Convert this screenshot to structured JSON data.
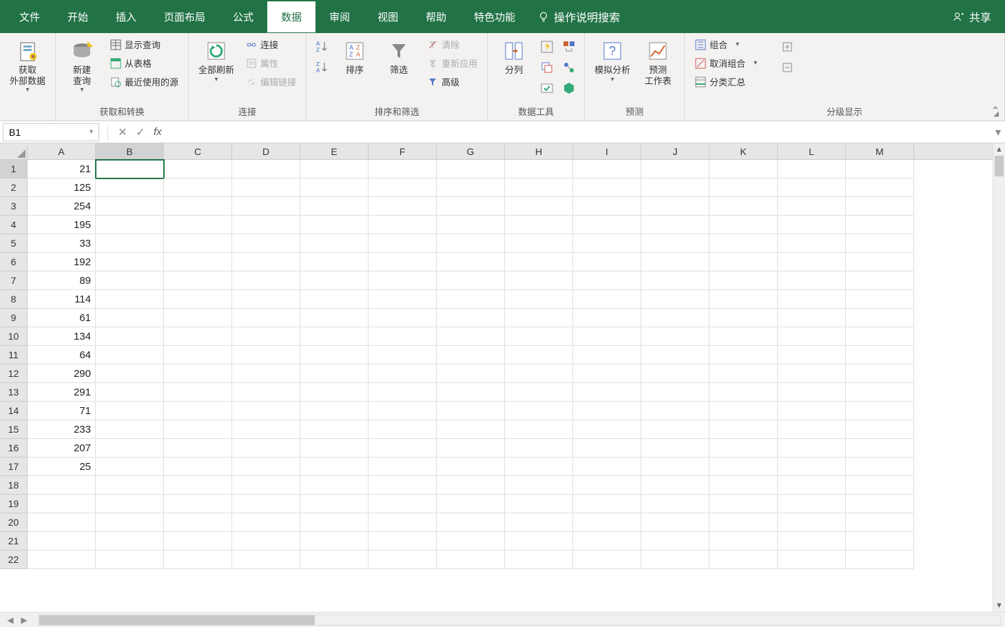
{
  "menubar": {
    "tabs": [
      "文件",
      "开始",
      "插入",
      "页面布局",
      "公式",
      "数据",
      "审阅",
      "视图",
      "帮助",
      "特色功能"
    ],
    "active_index": 5,
    "search_placeholder": "操作说明搜索",
    "share_label": "共享"
  },
  "ribbon": {
    "groups": [
      {
        "label": "",
        "big": [
          {
            "label": "获取\n外部数据",
            "caret": true
          }
        ]
      },
      {
        "label": "获取和转换",
        "big": [
          {
            "label": "新建\n查询",
            "caret": true
          }
        ],
        "small": [
          "显示查询",
          "从表格",
          "最近使用的源"
        ]
      },
      {
        "label": "连接",
        "big": [
          {
            "label": "全部刷新",
            "caret": true
          }
        ],
        "small": [
          "连接",
          "属性",
          "编辑链接"
        ],
        "small_disabled": [
          false,
          true,
          true
        ]
      },
      {
        "label": "排序和筛选",
        "big": [
          {
            "label": "排序"
          },
          {
            "label": "筛选"
          }
        ],
        "small": [
          "清除",
          "重新应用",
          "高级"
        ],
        "small_disabled": [
          true,
          true,
          false
        ]
      },
      {
        "label": "数据工具",
        "big": [
          {
            "label": "分列"
          }
        ]
      },
      {
        "label": "预测",
        "big": [
          {
            "label": "模拟分析",
            "caret": true
          },
          {
            "label": "预测\n工作表"
          }
        ]
      },
      {
        "label": "分级显示",
        "small": [
          "组合",
          "取消组合",
          "分类汇总"
        ],
        "small_caret": [
          true,
          true,
          false
        ]
      }
    ]
  },
  "formula_bar": {
    "name_box": "B1",
    "formula": ""
  },
  "grid": {
    "columns": [
      "A",
      "B",
      "C",
      "D",
      "E",
      "F",
      "G",
      "H",
      "I",
      "J",
      "K",
      "L",
      "M"
    ],
    "row_count": 22,
    "selected_cell": {
      "row": 1,
      "col": "B"
    },
    "data": {
      "A": [
        21,
        125,
        254,
        195,
        33,
        192,
        89,
        114,
        61,
        134,
        64,
        290,
        291,
        71,
        233,
        207,
        25
      ]
    }
  }
}
